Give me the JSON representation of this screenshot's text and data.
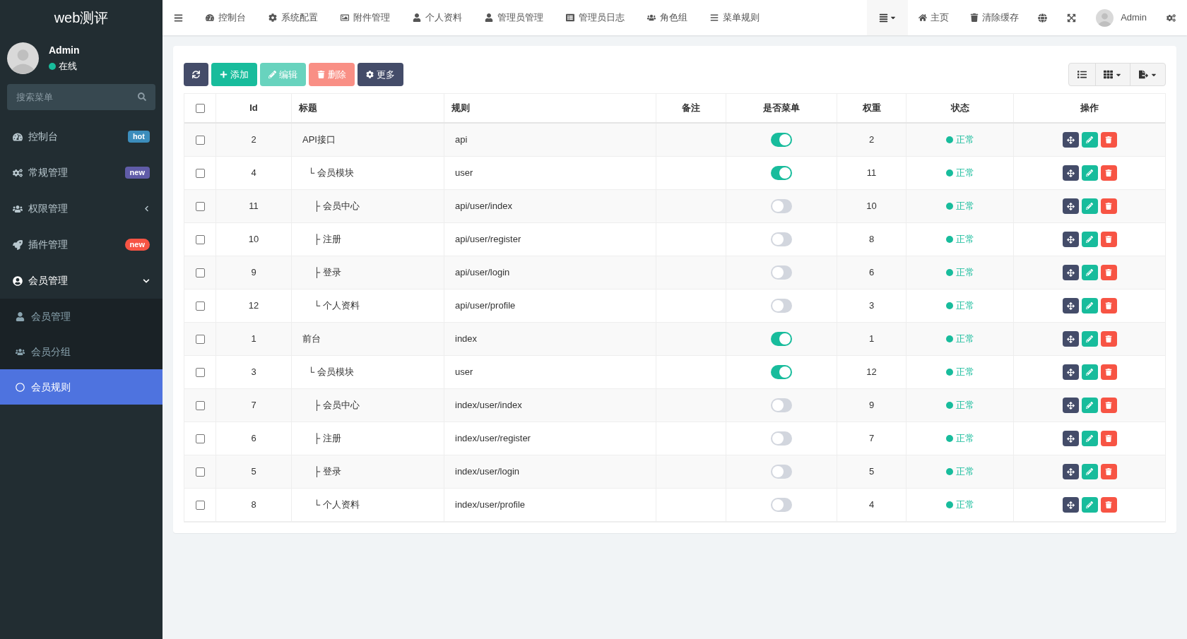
{
  "sidebar": {
    "logo": "web测评",
    "user": {
      "name": "Admin",
      "status": "在线"
    },
    "search": {
      "placeholder": "搜索菜单"
    },
    "items": [
      {
        "label": "控制台",
        "badge": {
          "text": "hot",
          "color": "#3c8dbc"
        },
        "expanded": false
      },
      {
        "label": "常规管理",
        "badge": {
          "text": "new",
          "color": "#605ca8"
        },
        "expanded": false
      },
      {
        "label": "权限管理",
        "expanded": false
      },
      {
        "label": "插件管理",
        "badge": {
          "text": "new",
          "color": "#f75444"
        },
        "expanded": false
      },
      {
        "label": "会员管理",
        "expanded": true,
        "children": [
          {
            "label": "会员管理",
            "selected": false
          },
          {
            "label": "会员分组",
            "selected": false
          },
          {
            "label": "会员规则",
            "selected": true
          }
        ]
      }
    ]
  },
  "topnav": {
    "tabs": [
      {
        "label": "控制台"
      },
      {
        "label": "系统配置"
      },
      {
        "label": "附件管理"
      },
      {
        "label": "个人资料"
      },
      {
        "label": "管理员管理"
      },
      {
        "label": "管理员日志"
      },
      {
        "label": "角色组"
      },
      {
        "label": "菜单规则"
      }
    ],
    "right": [
      {
        "label": "主页"
      },
      {
        "label": "清除缓存"
      }
    ],
    "user": "Admin"
  },
  "toolbar": {
    "buttons": [
      {
        "kind": "refresh",
        "disabled": false
      },
      {
        "kind": "add",
        "label": "添加",
        "disabled": false
      },
      {
        "kind": "edit",
        "label": "编辑",
        "disabled": true
      },
      {
        "kind": "delete",
        "label": "删除",
        "disabled": true
      },
      {
        "kind": "more",
        "label": "更多",
        "disabled": false
      }
    ]
  },
  "table": {
    "columns": [
      "Id",
      "标题",
      "规则",
      "备注",
      "是否菜单",
      "权重",
      "状态",
      "操作"
    ],
    "all_checked": false,
    "rows": [
      {
        "id": "2",
        "title": "API接口",
        "rule": "api",
        "menu": true,
        "weigh": "2",
        "status": "正常",
        "checked": false,
        "children": [
          {
            "id": "4",
            "title": "└ 会员模块",
            "rule": "user",
            "menu": true,
            "weigh": "11",
            "status": "正常",
            "checked": false,
            "children": [
              {
                "id": "11",
                "title": "├ 会员中心",
                "rule": "api/user/index",
                "menu": false,
                "weigh": "10",
                "status": "正常",
                "checked": false
              },
              {
                "id": "10",
                "title": "├ 注册",
                "rule": "api/user/register",
                "menu": false,
                "weigh": "8",
                "status": "正常",
                "checked": false
              },
              {
                "id": "9",
                "title": "├ 登录",
                "rule": "api/user/login",
                "menu": false,
                "weigh": "6",
                "status": "正常",
                "checked": false
              },
              {
                "id": "12",
                "title": "└ 个人资料",
                "rule": "api/user/profile",
                "menu": false,
                "weigh": "3",
                "status": "正常",
                "checked": false
              }
            ]
          }
        ]
      },
      {
        "id": "1",
        "title": "前台",
        "rule": "index",
        "menu": true,
        "weigh": "1",
        "status": "正常",
        "checked": false,
        "children": [
          {
            "id": "3",
            "title": "└ 会员模块",
            "rule": "user",
            "menu": true,
            "weigh": "12",
            "status": "正常",
            "checked": false,
            "children": [
              {
                "id": "7",
                "title": "├ 会员中心",
                "rule": "index/user/index",
                "menu": false,
                "weigh": "9",
                "status": "正常",
                "checked": false
              },
              {
                "id": "6",
                "title": "├ 注册",
                "rule": "index/user/register",
                "menu": false,
                "weigh": "7",
                "status": "正常",
                "checked": false
              },
              {
                "id": "5",
                "title": "├ 登录",
                "rule": "index/user/login",
                "menu": false,
                "weigh": "5",
                "status": "正常",
                "checked": false
              },
              {
                "id": "8",
                "title": "└ 个人资料",
                "rule": "index/user/profile",
                "menu": false,
                "weigh": "4",
                "status": "正常",
                "checked": false
              }
            ]
          }
        ]
      }
    ]
  }
}
